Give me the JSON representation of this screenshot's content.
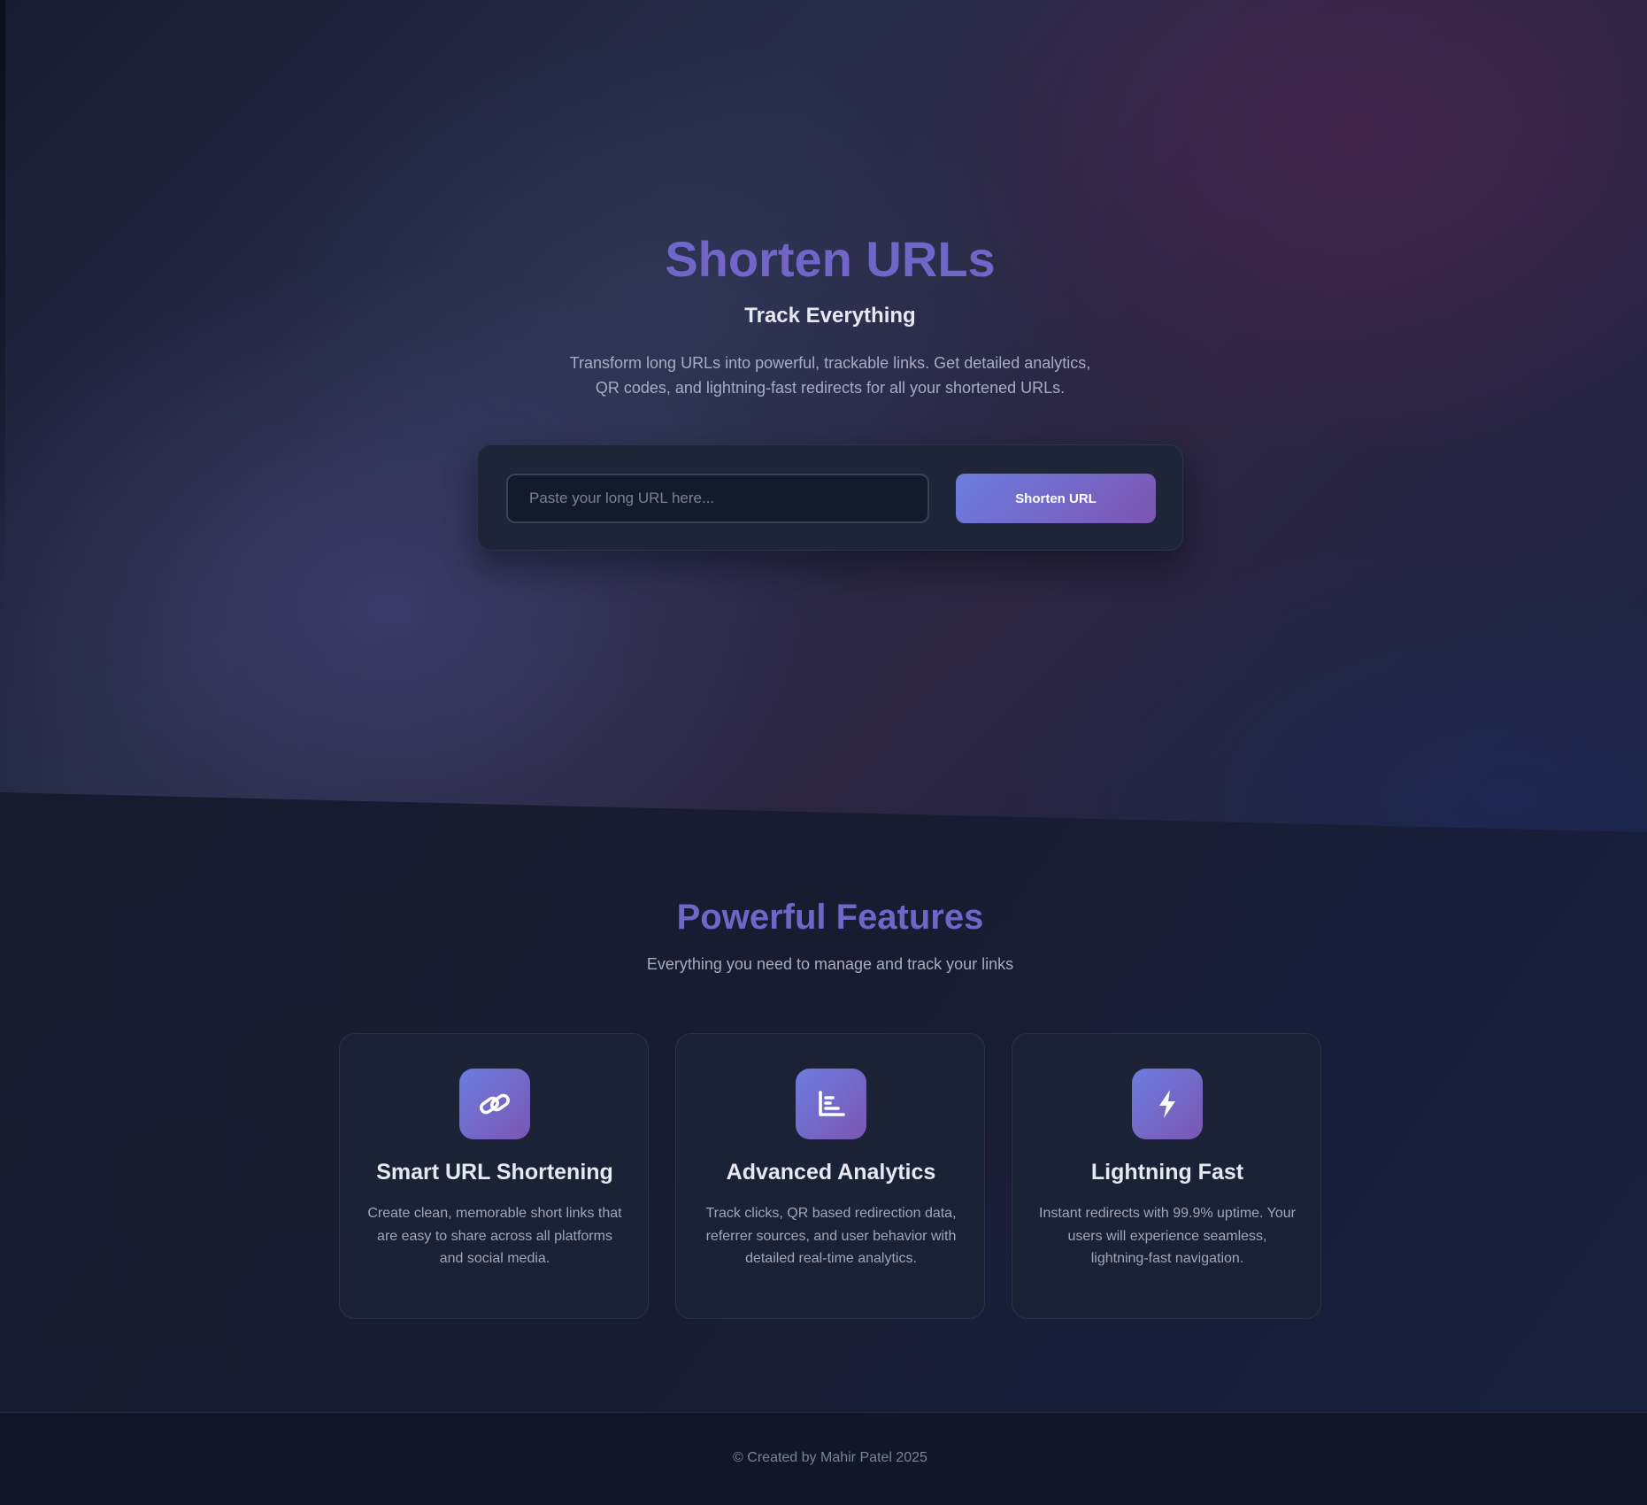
{
  "hero": {
    "title": "Shorten URLs",
    "subtitle": "Track Everything",
    "description": "Transform long URLs into powerful, trackable links. Get detailed analytics, QR codes, and lightning-fast redirects for all your shortened URLs.",
    "input": {
      "placeholder": "Paste your long URL here...",
      "value": ""
    },
    "button_label": "Shorten URL"
  },
  "features": {
    "title": "Powerful Features",
    "subtitle": "Everything you need to manage and track your links",
    "cards": [
      {
        "icon": "link-icon",
        "title": "Smart URL Shortening",
        "description": "Create clean, memorable short links that are easy to share across all platforms and social media."
      },
      {
        "icon": "bar-chart-icon",
        "title": "Advanced Analytics",
        "description": "Track clicks, QR based redirection data, referrer sources, and user behavior with detailed real-time analytics."
      },
      {
        "icon": "lightning-bolt-icon",
        "title": "Lightning Fast",
        "description": "Instant redirects with 99.9% uptime. Your users will experience seamless, lightning-fast navigation."
      }
    ]
  },
  "footer": {
    "text": "© Created by Mahir Patel 2025"
  },
  "colors": {
    "accent": "#7166c8",
    "gradient_start": "#6b7de0",
    "gradient_end": "#7c55b2",
    "background": "#161a2e",
    "card_background": "#1b2236",
    "text_primary": "#e6e8f2",
    "text_secondary": "#a7adc1"
  }
}
